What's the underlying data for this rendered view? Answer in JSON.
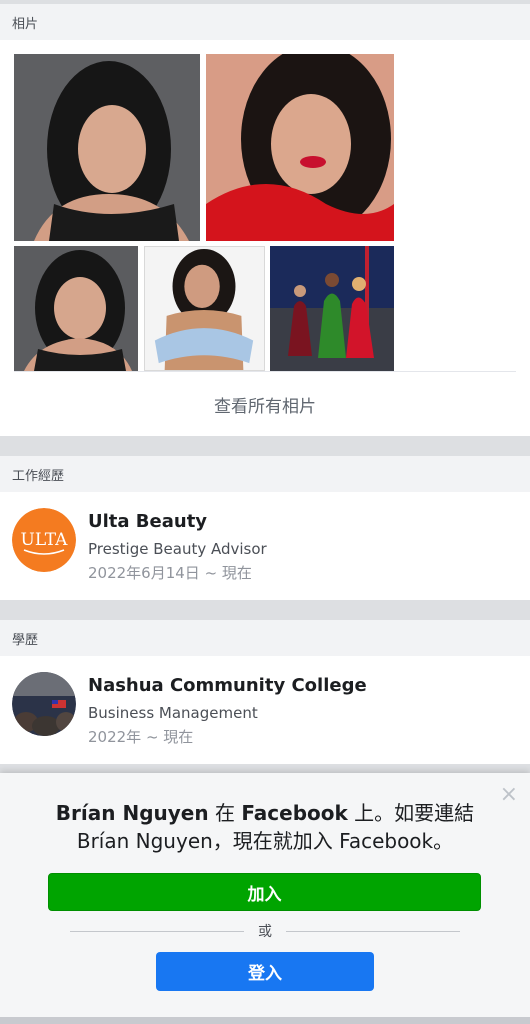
{
  "photos": {
    "header": "相片",
    "view_all": "查看所有相片",
    "items": [
      "photo-portrait-black-top",
      "photo-red-dress",
      "photo-portrait-black-top-2",
      "photo-blue-top",
      "photo-group-gowns"
    ]
  },
  "work": {
    "header": "工作經歷",
    "company": "Ulta Beauty",
    "role": "Prestige Beauty Advisor",
    "dates": "2022年6月14日 ~ 現在",
    "logo_text": "ULTA",
    "logo_color": "#f47b20"
  },
  "education": {
    "header": "學歷",
    "school": "Nashua Community College",
    "field": "Business Management",
    "dates": "2022年 ~ 現在"
  },
  "prompt": {
    "name_1": "Brían Nguyen",
    "text_1": " 在 ",
    "brand": "Facebook",
    "text_2": " 上。如要連結",
    "line_2": "Brían Nguyen，現在就加入 Facebook。",
    "join_label": "加入",
    "or_label": "或",
    "login_label": "登入",
    "close_glyph": "×",
    "join_color": "#00a400",
    "login_color": "#1877f2"
  }
}
